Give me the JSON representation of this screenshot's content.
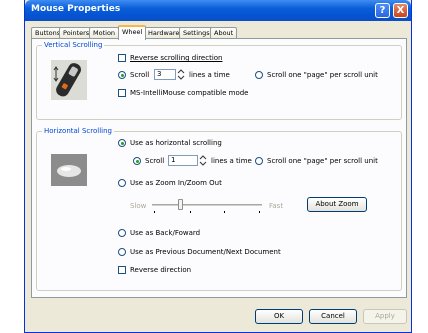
{
  "window": {
    "title": "Mouse Properties",
    "help_glyph": "?",
    "close_glyph": "X"
  },
  "tabs": [
    "Buttons",
    "Pointers",
    "Motion",
    "Wheel",
    "Hardware",
    "Settings",
    "About"
  ],
  "active_tab": "Wheel",
  "vertical": {
    "label": "Vertical Scrolling",
    "reverse": {
      "label": "Reverse scrolling direction",
      "checked": false
    },
    "scroll_lines": {
      "label_pre": "Scroll",
      "value": "3",
      "label_post": "lines a time",
      "selected": true
    },
    "scroll_page": {
      "label": "Scroll one \"page\" per scroll unit",
      "selected": false
    },
    "ms_compat": {
      "label": "MS-IntelliMouse compatible mode",
      "checked": false
    }
  },
  "horizontal": {
    "label": "Horizontal Scrolling",
    "use_horizontal": {
      "label": "Use as horizontal scrolling",
      "selected": true
    },
    "scroll_lines": {
      "label_pre": "Scroll",
      "value": "1",
      "label_post": "lines a time",
      "selected": true
    },
    "scroll_page": {
      "label": "Scroll one \"page\" per scroll unit",
      "selected": false
    },
    "zoom": {
      "label": "Use as Zoom In/Zoom Out",
      "selected": false
    },
    "slow_label": "Slow",
    "fast_label": "Fast",
    "slider_level": 0.25,
    "about_zoom": "About Zoom",
    "back_forward": {
      "label": "Use as Back/Foward",
      "selected": false
    },
    "prev_next": {
      "label": "Use as Previous Document/Next Document",
      "selected": false
    },
    "reverse": {
      "label": "Reverse direction",
      "checked": false
    }
  },
  "buttons": {
    "ok": "OK",
    "cancel": "Cancel",
    "apply": "Apply"
  }
}
